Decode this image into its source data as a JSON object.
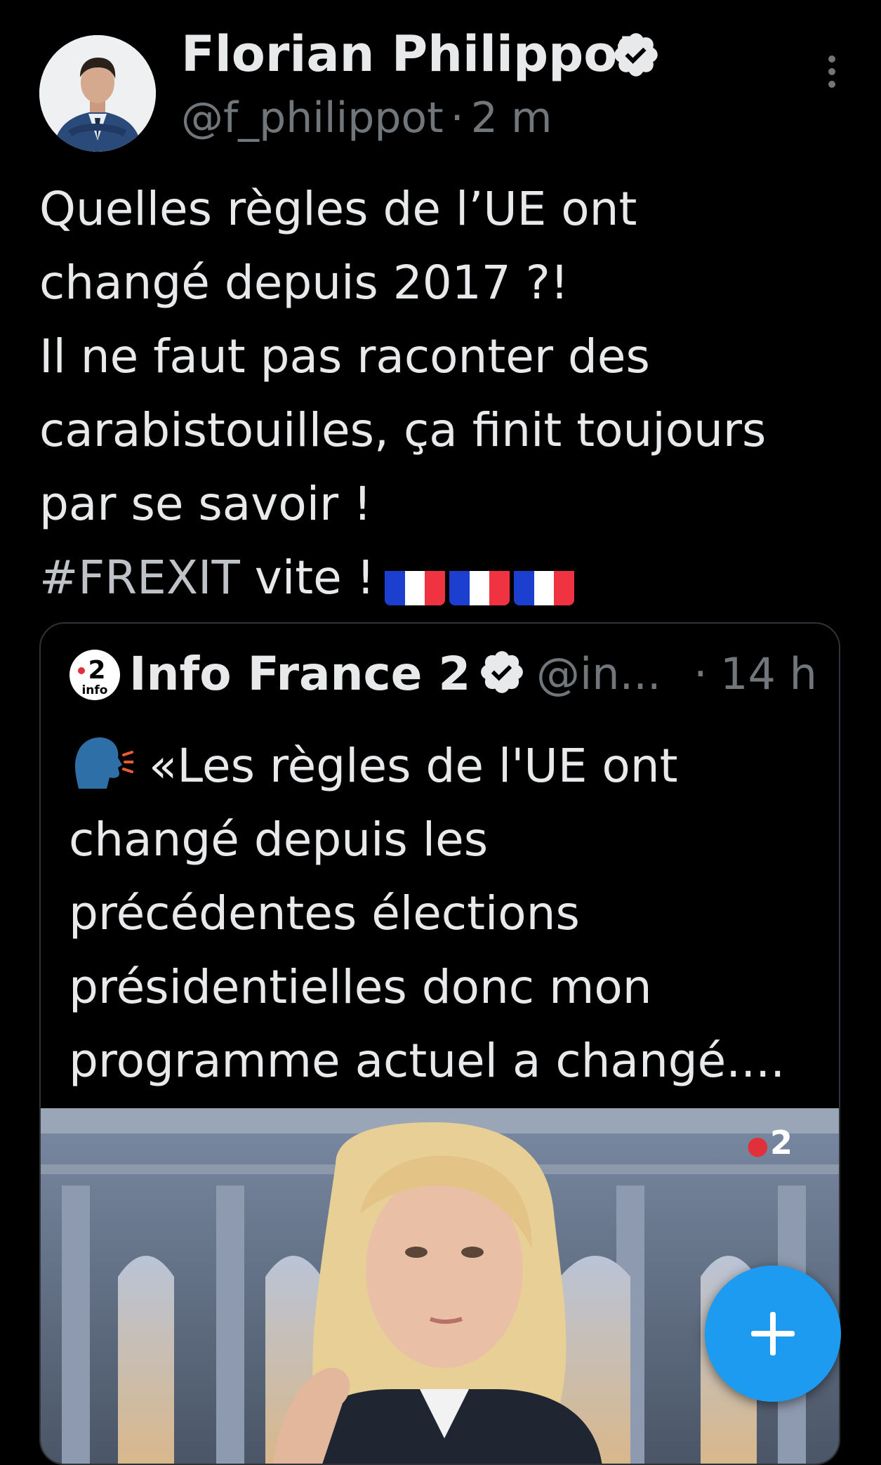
{
  "tweet": {
    "author_name": "Florian Philippot",
    "handle": "@f_philippot",
    "separator": "·",
    "time": "2 m",
    "text_lines": [
      "Quelles règles de l’UE ont",
      "changé depuis 2017 ?!",
      "Il ne faut pas raconter des",
      "carabistouilles, ça finit toujours",
      "par se savoir !"
    ],
    "hashtag": "#FREXIT",
    "hashtag_suffix": " vite !",
    "flag_emoji_count": 3,
    "icons": {
      "verified": "verified-badge-icon",
      "more": "more-options-icon",
      "flag": "france-flag-icon"
    }
  },
  "quoted": {
    "source_logo_text": "2",
    "source_logo_sub": "info",
    "name": "Info France 2",
    "handle": "@in...",
    "separator": "·",
    "time": "14 h",
    "text_lines": [
      "«Les règles de l'UE ont",
      "changé depuis les",
      "précédentes élections",
      "présidentielles donc mon",
      "programme actuel a changé...."
    ],
    "media_badge": "2",
    "icons": {
      "speaking_head": "speaking-head-icon",
      "verified": "verified-badge-icon"
    }
  },
  "fab": {
    "icon": "plus-icon"
  },
  "colors": {
    "background": "#000000",
    "text": "#e7e9ea",
    "muted": "#71767b",
    "accent": "#1d9bf0",
    "border": "#2f3336"
  }
}
